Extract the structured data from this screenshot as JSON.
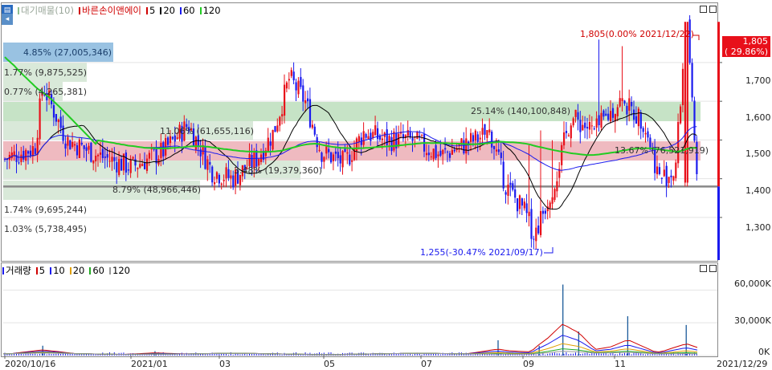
{
  "price_panel": {
    "legend": {
      "main_label": "대기매물(10)",
      "stock_label": "바른손이앤에이",
      "ma": [
        {
          "label": "5",
          "color": "#d00000"
        },
        {
          "label": "20",
          "color": "#000000"
        },
        {
          "label": "60",
          "color": "#1a1aee"
        },
        {
          "label": "120",
          "color": "#22cc22"
        }
      ]
    },
    "y_ticks": [
      "1,700",
      "1,600",
      "1,500",
      "1,400",
      "1,300"
    ],
    "current_price_badge": {
      "price": "1,805",
      "change": "( 29.86%)"
    },
    "supply_zones": [
      {
        "label": "4.85% (27,005,346)",
        "color": "#7fb3db"
      },
      {
        "label": "1.77% (9,875,525)",
        "color": "#cfe3cf"
      },
      {
        "label": "0.77% (4,265,381)",
        "color": "#cfe3cf"
      },
      {
        "label": "25.14% (140,100,848)",
        "color": "#b8dcb8"
      },
      {
        "label": "11.06% (61,655,116)",
        "color": "#cfe3cf"
      },
      {
        "label": "13.67% (76,521,919)",
        "color": "#e9a3ab"
      },
      {
        "label": "3.48% (19,379,360)",
        "color": "#cfe3cf"
      },
      {
        "label": "8.79% (48,966,446)",
        "color": "#cfe3cf"
      },
      {
        "label": "1.74% (9,695,244)",
        "color": "#ffffff"
      },
      {
        "label": "1.03% (5,738,495)",
        "color": "#ffffff"
      }
    ],
    "high_annotation": "1,805(0.00% 2021/12/22)",
    "low_annotation": "1,255(-30.47% 2021/09/17)"
  },
  "volume_panel": {
    "legend": {
      "main_label": "거래량",
      "ma": [
        {
          "label": "5",
          "color": "#d00000"
        },
        {
          "label": "10",
          "color": "#1a1aee"
        },
        {
          "label": "20",
          "color": "#e0a000"
        },
        {
          "label": "60",
          "color": "#22aa22"
        },
        {
          "label": "120",
          "color": "#999999"
        }
      ]
    },
    "y_ticks": [
      "60,000K",
      "30,000K",
      "0K"
    ]
  },
  "x_axis": {
    "labels": [
      "2020/10/16",
      "2021/01",
      "03",
      "05",
      "07",
      "09",
      "11",
      "2021/12/29"
    ]
  },
  "chart_data": {
    "type": "candlestick",
    "title": "바른손이앤에이",
    "x_range": [
      "2020/10/16",
      "2021/12/29"
    ],
    "price_ylim": [
      1190,
      1820
    ],
    "volume_ylim": [
      0,
      72000
    ],
    "volume_unit": "K",
    "moving_averages": [
      "5",
      "20",
      "60",
      "120"
    ],
    "support_line": 1380,
    "price_path": [
      {
        "date": "2020/10/16",
        "close": 1450
      },
      {
        "date": "2020/11/05",
        "close": 1480
      },
      {
        "date": "2020/11/10",
        "close": 1640
      },
      {
        "date": "2020/11/25",
        "close": 1500
      },
      {
        "date": "2020/12/15",
        "close": 1460
      },
      {
        "date": "2021/01/05",
        "close": 1430
      },
      {
        "date": "2021/01/25",
        "close": 1470
      },
      {
        "date": "2021/02/10",
        "close": 1540
      },
      {
        "date": "2021/02/25",
        "close": 1420
      },
      {
        "date": "2021/03/10",
        "close": 1400
      },
      {
        "date": "2021/03/25",
        "close": 1450
      },
      {
        "date": "2021/04/05",
        "close": 1520
      },
      {
        "date": "2021/04/15",
        "close": 1660
      },
      {
        "date": "2021/04/25",
        "close": 1600
      },
      {
        "date": "2021/05/05",
        "close": 1470
      },
      {
        "date": "2021/05/20",
        "close": 1440
      },
      {
        "date": "2021/06/01",
        "close": 1520
      },
      {
        "date": "2021/06/15",
        "close": 1500
      },
      {
        "date": "2021/07/01",
        "close": 1500
      },
      {
        "date": "2021/07/20",
        "close": 1460
      },
      {
        "date": "2021/08/10",
        "close": 1500
      },
      {
        "date": "2021/08/20",
        "close": 1520
      },
      {
        "date": "2021/08/30",
        "close": 1380
      },
      {
        "date": "2021/09/10",
        "close": 1320
      },
      {
        "date": "2021/09/17",
        "close": 1255
      },
      {
        "date": "2021/09/30",
        "close": 1400
      },
      {
        "date": "2021/10/10",
        "close": 1560
      },
      {
        "date": "2021/10/25",
        "close": 1520
      },
      {
        "date": "2021/11/10",
        "close": 1600
      },
      {
        "date": "2021/11/25",
        "close": 1550
      },
      {
        "date": "2021/12/05",
        "close": 1400
      },
      {
        "date": "2021/12/15",
        "close": 1420
      },
      {
        "date": "2021/12/22",
        "close": 1805
      },
      {
        "date": "2021/12/29",
        "close": 1380
      }
    ],
    "volume_spikes": [
      {
        "date": "2020/11/10",
        "value": 9000
      },
      {
        "date": "2021/01/20",
        "value": 4000
      },
      {
        "date": "2021/08/25",
        "value": 14000
      },
      {
        "date": "2021/09/20",
        "value": 9000
      },
      {
        "date": "2021/10/05",
        "value": 65000
      },
      {
        "date": "2021/10/15",
        "value": 22000
      },
      {
        "date": "2021/11/15",
        "value": 36000
      },
      {
        "date": "2021/12/22",
        "value": 28000
      }
    ]
  }
}
